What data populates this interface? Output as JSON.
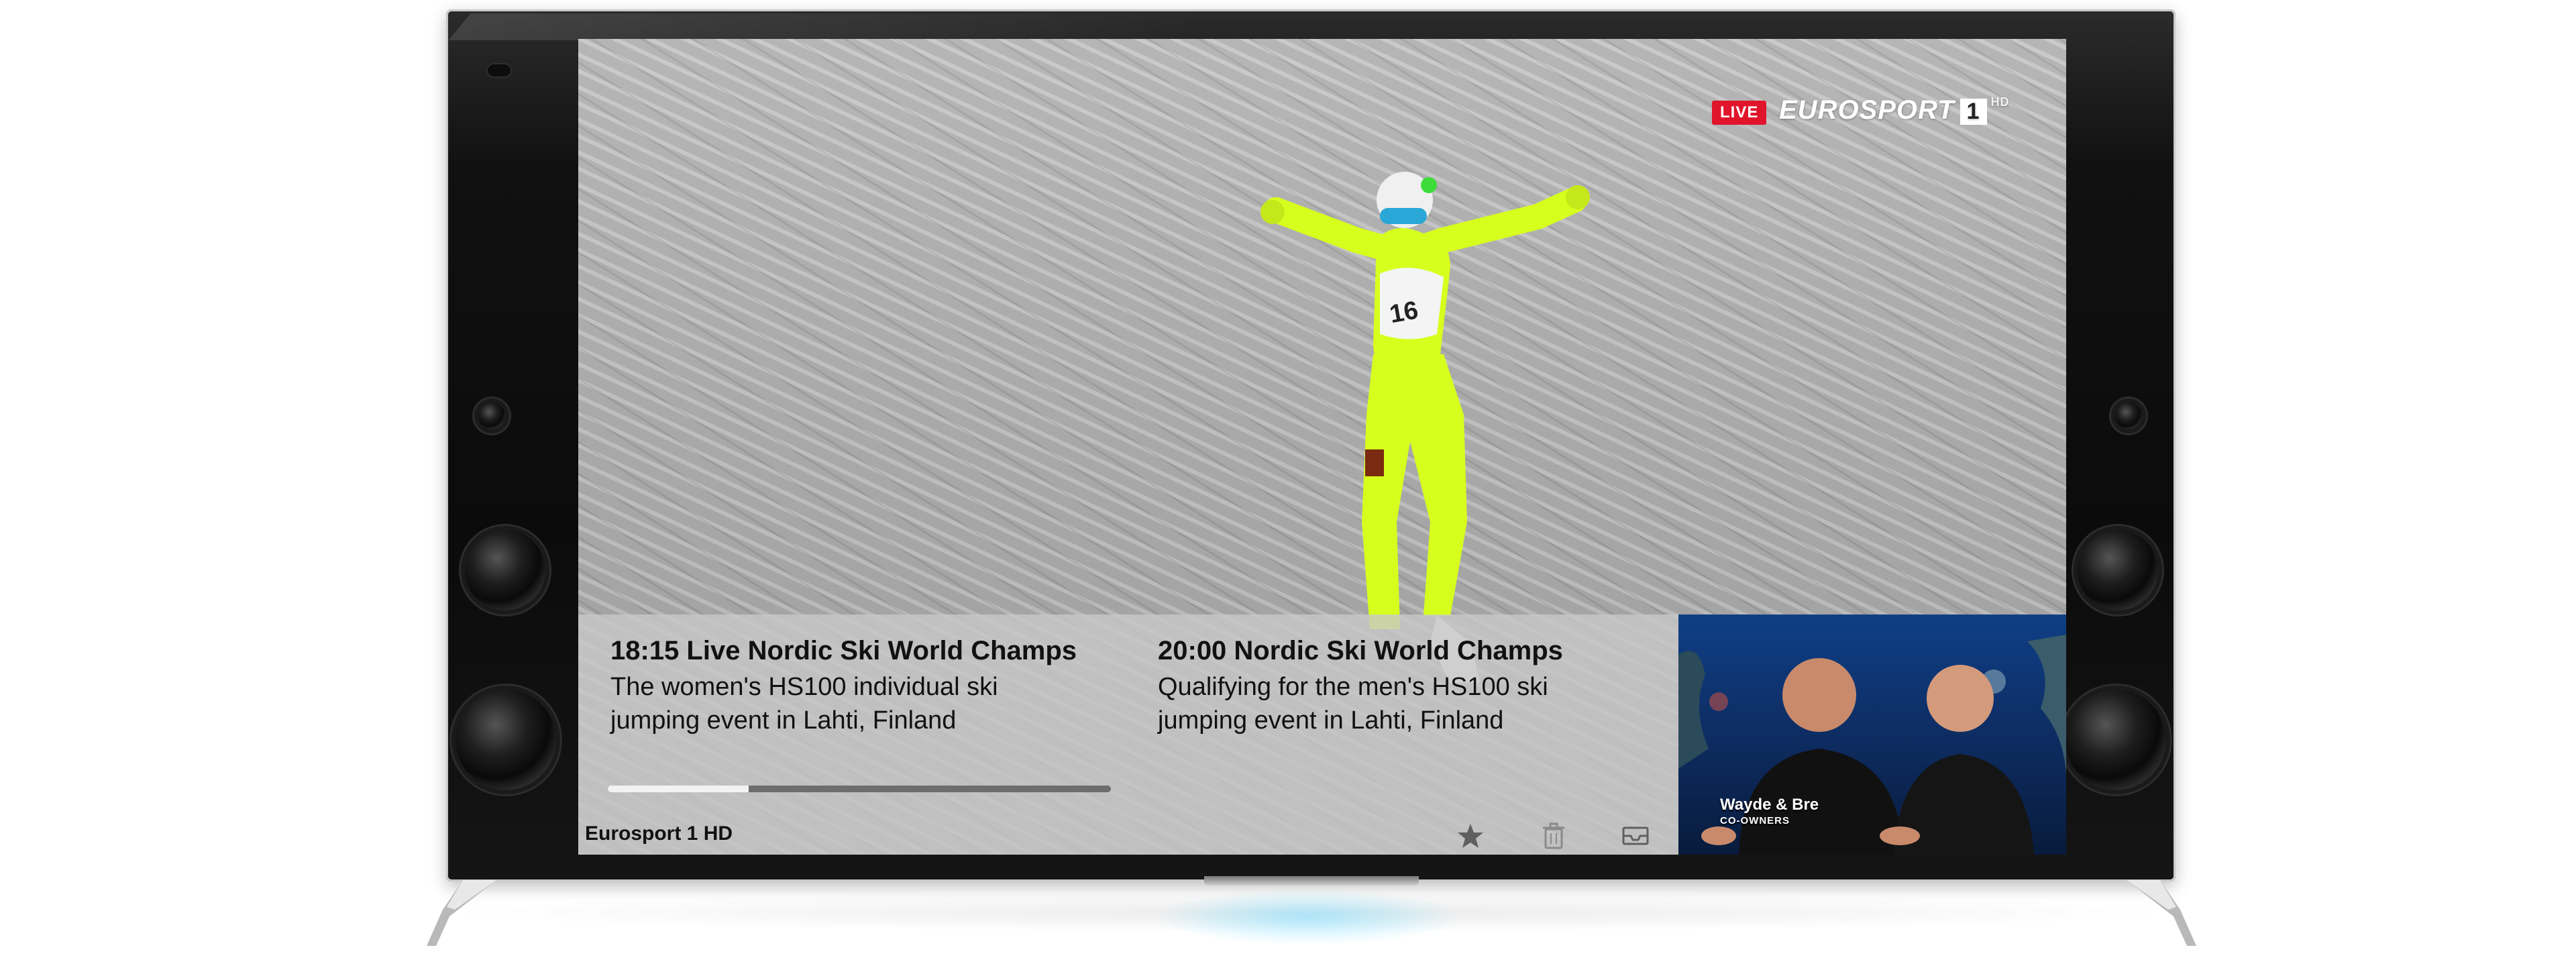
{
  "broadcast": {
    "live_label": "LIVE",
    "channel_logo": "EUROSPORT",
    "channel_number": "1",
    "channel_hd": "HD"
  },
  "now_playing": {
    "title": "18:15 Live Nordic Ski World Champs",
    "description": "The women's HS100 individual ski jumping event in Lahti, Finland",
    "progress": 0.28
  },
  "up_next": {
    "title": "20:00 Nordic Ski World Champs",
    "description": "Qualifying for the men's HS100 ski jumping event in Lahti, Finland"
  },
  "channel": {
    "name": "Eurosport 1 HD"
  },
  "actions": [
    {
      "name": "favorite",
      "icon": "star-icon"
    },
    {
      "name": "delete",
      "icon": "trash-icon"
    },
    {
      "name": "inbox",
      "icon": "inbox-icon"
    }
  ],
  "pip": {
    "caption_line1": "Wayde & Bre",
    "caption_line2": "CO-OWNERS"
  },
  "colors": {
    "live_red": "#e0152b",
    "jumper_suit": "#d7ff1e",
    "overlay": "#c8c8c8"
  }
}
